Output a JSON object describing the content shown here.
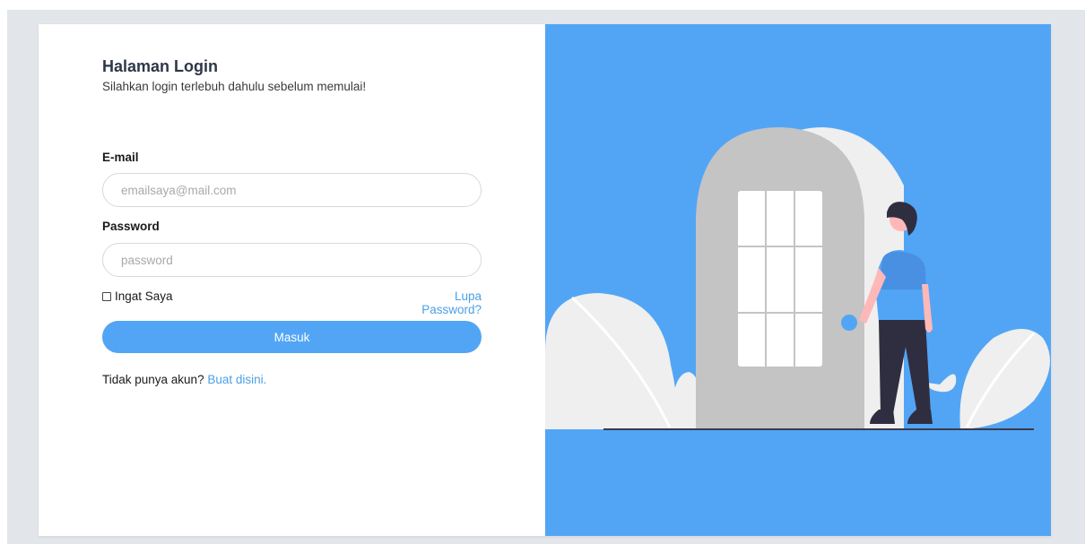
{
  "login": {
    "title": "Halaman Login",
    "subtitle": "Silahkan login terlebuh dahulu sebelum memulai!",
    "email_label": "E-mail",
    "email_placeholder": "emailsaya@mail.com",
    "password_label": "Password",
    "password_placeholder": "password",
    "remember_label": "Ingat Saya",
    "forgot_label": "Lupa Password?",
    "submit_label": "Masuk",
    "register_prompt": "Tidak punya akun?",
    "register_link": "Buat disini."
  },
  "theme": {
    "accent": "#52a5f5",
    "link": "#4c9fe6",
    "illustration_bg": "#52a5f5",
    "page_bg": "#e2e6ea"
  },
  "icons": [
    "checkbox-icon"
  ]
}
